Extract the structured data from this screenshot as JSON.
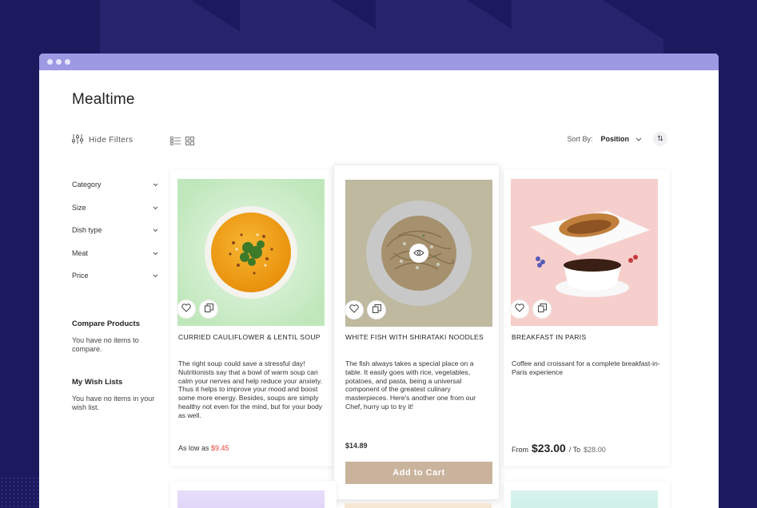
{
  "page": {
    "title": "Mealtime"
  },
  "toolbar": {
    "filters_label": "Hide Filters",
    "sort_label": "Sort By:",
    "sort_value": "Position"
  },
  "sidebar": {
    "filters": [
      {
        "label": "Category"
      },
      {
        "label": "Size"
      },
      {
        "label": "Dish type"
      },
      {
        "label": "Meat"
      },
      {
        "label": "Price"
      }
    ],
    "compare_title": "Compare Products",
    "compare_text": "You have no items to compare.",
    "wishlist_title": "My Wish Lists",
    "wishlist_text": "You have no items in your wish list."
  },
  "products": [
    {
      "name": "Curried Cauliflower & Lentil Soup",
      "description": "The right soup could save a stressful day! Nutritionists say that a bowl of warm soup can calm your nerves and help reduce your anxiety. Thus it helps to improve your mood and boost some more energy. Besides, soups are simply healthy not even for the mind, but for your body as well.",
      "price_prefix": "As low as",
      "price": "$9.45"
    },
    {
      "name": "White Fish with Shirataki Noodles",
      "description": "The fish always takes a special place on a table. It easily goes with rice, vegetables, potatoes, and pasta, being a universal component of the greatest culinary masterpieces. Here's another one from our Chef, hurry up to try it!",
      "price": "$14.89",
      "cart_label": "Add to Cart"
    },
    {
      "name": "Breakfast in Paris",
      "description": "Coffee and croissant for a complete breakfast-in-Paris experience",
      "price_from_label": "From",
      "price_from": "$23.00",
      "price_to_label": "/ To",
      "price_to": "$28.00"
    }
  ],
  "colors": {
    "accent": "#c9b39c",
    "special_price": "#e3463a",
    "titlebar": "#9d99e3",
    "background": "#1c1a5e"
  }
}
